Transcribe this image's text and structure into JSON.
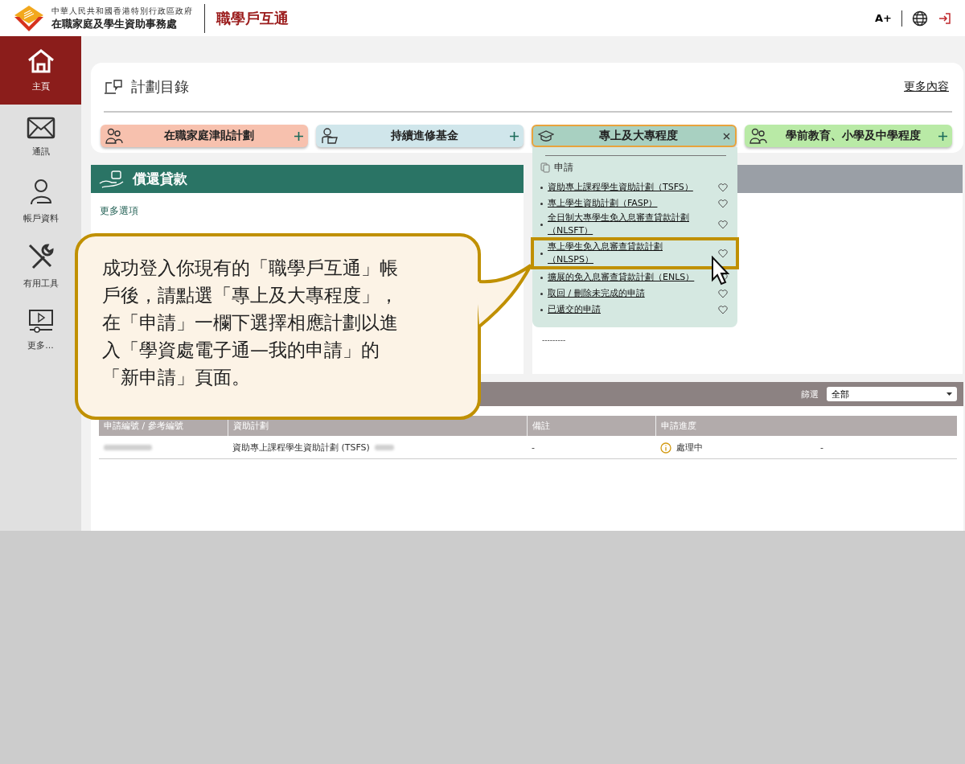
{
  "header": {
    "agency_small": "中華人民共和國香港特別行政區政府",
    "agency": "在職家庭及學生資助事務處",
    "brand": "職學戶互通",
    "font_button": "A+"
  },
  "sidebar": {
    "items": [
      {
        "label": "主頁",
        "selected": true
      },
      {
        "label": "通訊",
        "selected": false
      },
      {
        "label": "帳戶資料",
        "selected": false
      },
      {
        "label": "有用工具",
        "selected": false
      },
      {
        "label": "更多...",
        "selected": false
      }
    ]
  },
  "catalog": {
    "title": "計劃目錄",
    "more_link": "更多內容",
    "categories": [
      {
        "label": "在職家庭津貼計劃",
        "expanded": false,
        "color": "#f7c1ae"
      },
      {
        "label": "持續進修基金",
        "expanded": false,
        "color": "#d0e6eb"
      },
      {
        "label": "專上及大專程度",
        "expanded": true,
        "color": "#a8d0c1"
      },
      {
        "label": "學前教育、小學及中學程度",
        "expanded": false,
        "color": "#b9eaa6"
      }
    ]
  },
  "dropdown": {
    "section": "申請",
    "items": [
      {
        "label": "資助專上課程學生資助計劃（TSFS）",
        "highlighted": false
      },
      {
        "label": "專上學生資助計劃（FASP）",
        "highlighted": false
      },
      {
        "label": "全日制大專學生免入息審查貸款計劃（NLSFT）",
        "highlighted": false
      },
      {
        "label": "專上學生免入息審查貸款計劃（NLSPS）",
        "highlighted": true
      },
      {
        "label": "擴展的免入息審查貸款計劃（ENLS）",
        "highlighted": false
      },
      {
        "label": "取回 / 刪除未完成的申請",
        "highlighted": false
      },
      {
        "label": "已遞交的申請",
        "highlighted": false
      }
    ]
  },
  "repay_panel": {
    "title": "償還貸款",
    "more_options": "更多選項"
  },
  "right_panel": {
    "text": "---------"
  },
  "applications": {
    "filter_label": "篩選",
    "filter_value": "全部",
    "columns": [
      "申請編號 / 參考編號",
      "資助計劃",
      "備註",
      "申請進度"
    ],
    "rows": [
      {
        "plan": "資助專上課程學生資助計劃 (TSFS)",
        "remark": "-",
        "status": "處理中",
        "extra": "-"
      }
    ]
  },
  "callout": {
    "lines": [
      "成功登入你現有的「職學戶互通」帳",
      "戶後，請點選「專上及大專程度」，",
      "在「申請」一欄下選擇相應計劃以進",
      "入「學資處電子通—我的申請」的",
      "「新申請」頁面。"
    ]
  }
}
